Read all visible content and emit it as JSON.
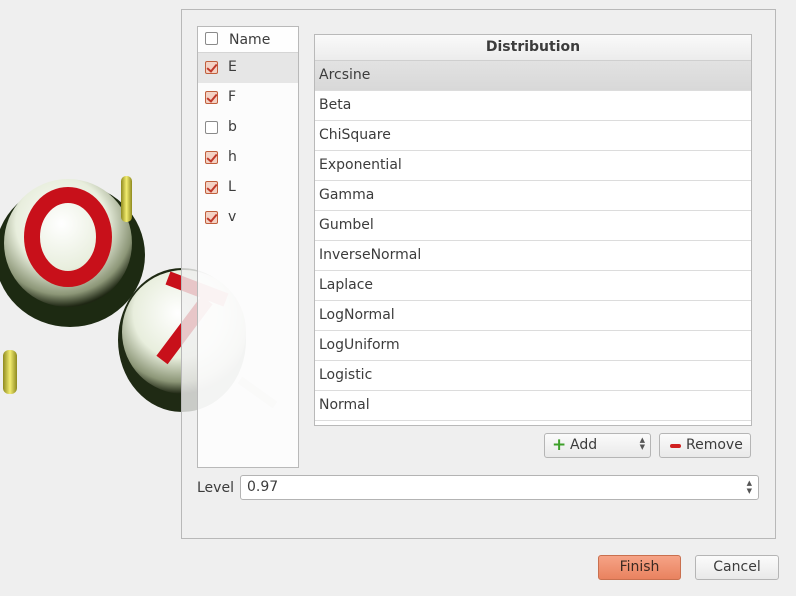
{
  "names": {
    "header": "Name",
    "header_checked": false,
    "items": [
      {
        "label": "E",
        "checked": true,
        "selected": true
      },
      {
        "label": "F",
        "checked": true,
        "selected": false
      },
      {
        "label": "b",
        "checked": false,
        "selected": false
      },
      {
        "label": "h",
        "checked": true,
        "selected": false
      },
      {
        "label": "L",
        "checked": true,
        "selected": false
      },
      {
        "label": "v",
        "checked": true,
        "selected": false
      }
    ]
  },
  "distribution": {
    "header": "Distribution",
    "rows": [
      "Arcsine",
      "Beta",
      "ChiSquare",
      "Exponential",
      "Gamma",
      "Gumbel",
      "InverseNormal",
      "Laplace",
      "LogNormal",
      "LogUniform",
      "Logistic",
      "Normal"
    ],
    "selected_index": 0
  },
  "buttons": {
    "add": "Add",
    "remove": "Remove",
    "finish": "Finish",
    "cancel": "Cancel"
  },
  "level": {
    "label": "Level",
    "value": "0.97"
  },
  "colors": {
    "accent": "#e9825f",
    "check": "#c0392b",
    "add_icon": "#3ea02a",
    "remove_icon": "#d02020"
  }
}
